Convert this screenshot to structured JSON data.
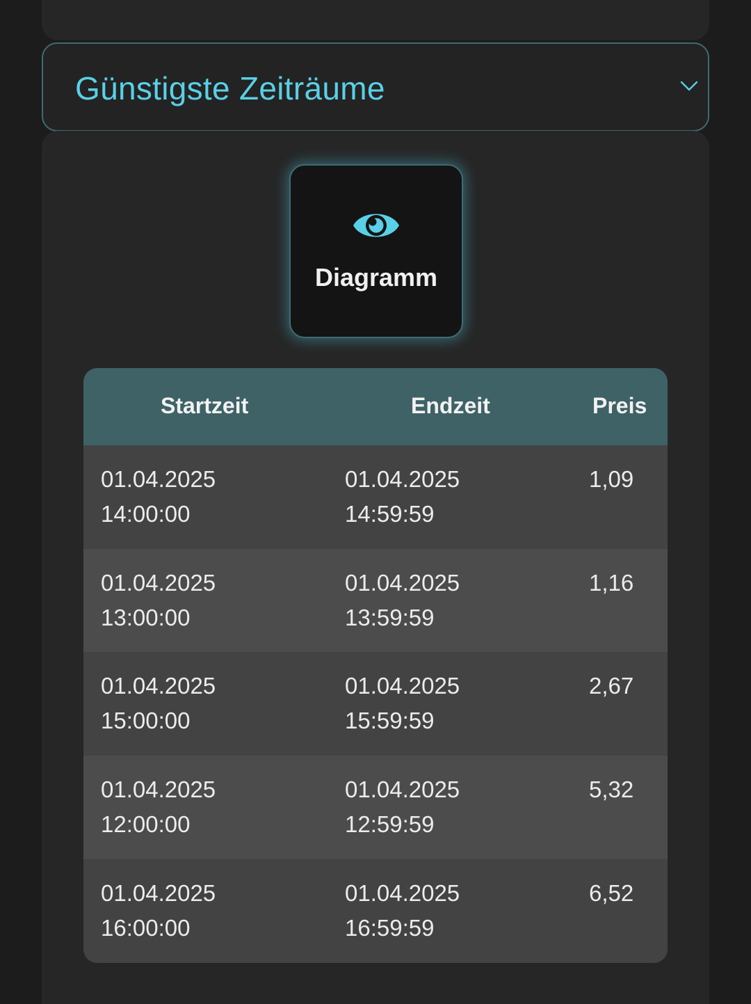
{
  "expander": {
    "title": "Günstigste Zeiträume",
    "chevron_icon": "chevron-down-icon",
    "accent_color": "#5ad0e6"
  },
  "diagram_button": {
    "label": "Diagramm",
    "icon": "eye-icon"
  },
  "table": {
    "headers": {
      "start": "Startzeit",
      "end": "Endzeit",
      "price": "Preis"
    },
    "rows": [
      {
        "start_date": "01.04.2025",
        "start_time": "14:00:00",
        "end_date": "01.04.2025",
        "end_time": "14:59:59",
        "price": "1,09"
      },
      {
        "start_date": "01.04.2025",
        "start_time": "13:00:00",
        "end_date": "01.04.2025",
        "end_time": "13:59:59",
        "price": "1,16"
      },
      {
        "start_date": "01.04.2025",
        "start_time": "15:00:00",
        "end_date": "01.04.2025",
        "end_time": "15:59:59",
        "price": "2,67"
      },
      {
        "start_date": "01.04.2025",
        "start_time": "12:00:00",
        "end_date": "01.04.2025",
        "end_time": "12:59:59",
        "price": "5,32"
      },
      {
        "start_date": "01.04.2025",
        "start_time": "16:00:00",
        "end_date": "01.04.2025",
        "end_time": "16:59:59",
        "price": "6,52"
      }
    ]
  }
}
